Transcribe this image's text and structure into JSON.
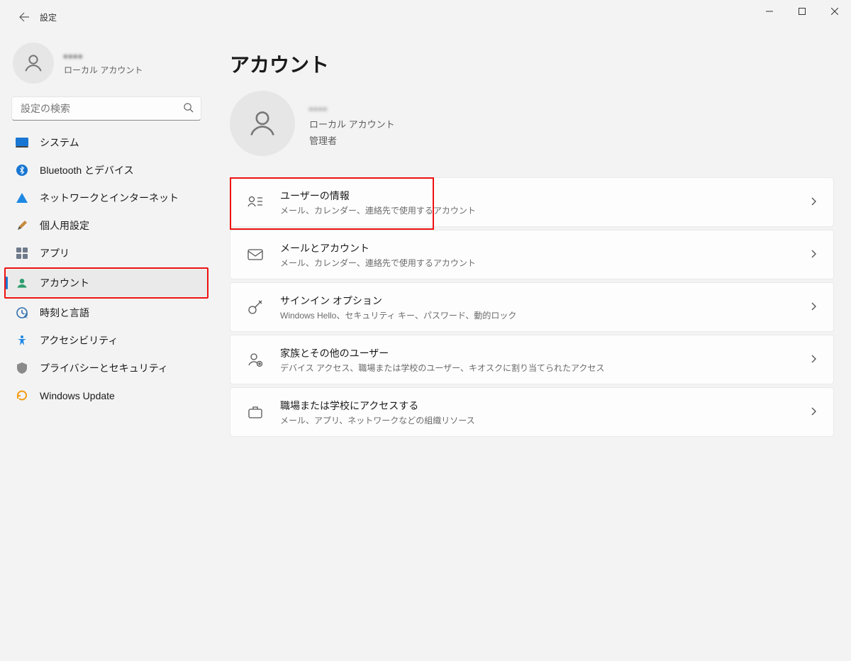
{
  "window": {
    "title": "設定"
  },
  "sidebar": {
    "user": {
      "name": "▪▪▪▪",
      "sub": "ローカル アカウント"
    },
    "search_placeholder": "設定の検索",
    "items": [
      {
        "label": "システム"
      },
      {
        "label": "Bluetooth とデバイス"
      },
      {
        "label": "ネットワークとインターネット"
      },
      {
        "label": "個人用設定"
      },
      {
        "label": "アプリ"
      },
      {
        "label": "アカウント"
      },
      {
        "label": "時刻と言語"
      },
      {
        "label": "アクセシビリティ"
      },
      {
        "label": "プライバシーとセキュリティ"
      },
      {
        "label": "Windows Update"
      }
    ]
  },
  "page": {
    "title": "アカウント",
    "user": {
      "name": "▪▪▪▪",
      "line1": "ローカル アカウント",
      "line2": "管理者"
    },
    "cards": [
      {
        "title": "ユーザーの情報",
        "sub": "メール、カレンダー、連絡先で使用するアカウント"
      },
      {
        "title": "メールとアカウント",
        "sub": "メール、カレンダー、連絡先で使用するアカウント"
      },
      {
        "title": "サインイン オプション",
        "sub": "Windows Hello、セキュリティ キー、パスワード、動的ロック"
      },
      {
        "title": "家族とその他のユーザー",
        "sub": "デバイス アクセス、職場または学校のユーザー、キオスクに割り当てられたアクセス"
      },
      {
        "title": "職場または学校にアクセスする",
        "sub": "メール、アプリ、ネットワークなどの組織リソース"
      }
    ]
  }
}
